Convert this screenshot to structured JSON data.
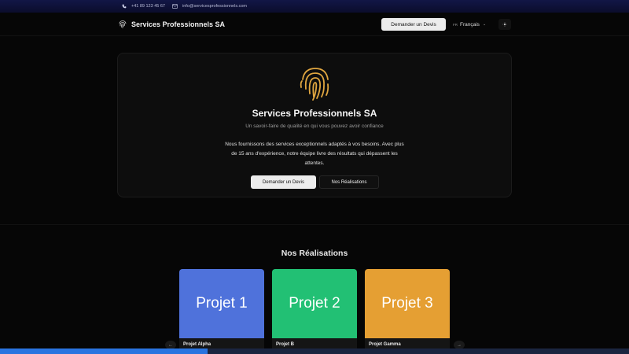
{
  "topbar": {
    "phone": "+41 89 123 45 67",
    "email": "info@servicesprofessionnels.com",
    "phone_icon": "phone-icon",
    "email_icon": "mail-icon"
  },
  "nav": {
    "brand_name": "Services Professionnels SA",
    "brand_icon": "fingerprint-icon",
    "quote_button": "Demander un Devis",
    "lang_code": "FR",
    "lang_label": "Français",
    "theme_icon": "sun-icon"
  },
  "hero": {
    "title": "Services Professionnels SA",
    "subtitle": "Un savoir-faire de qualité en qui vous pouvez avoir confiance",
    "description": "Nous fournissons des services exceptionnels adaptés à vos besoins. Avec plus de 15 ans d'expérience, notre équipe livre des résultats qui dépassent les attentes.",
    "primary_button": "Demander un Devis",
    "secondary_button": "Nos Réalisations",
    "accent_color": "#e0a640"
  },
  "portfolio": {
    "title": "Nos Réalisations",
    "prev_icon": "arrow-left-icon",
    "next_icon": "arrow-right-icon",
    "items": [
      {
        "label": "Projet 1",
        "caption": "Projet Alpha",
        "color": "#4f72db"
      },
      {
        "label": "Projet 2",
        "caption": "Projet B",
        "color": "#22c074"
      },
      {
        "label": "Projet 3",
        "caption": "Projet Gamma",
        "color": "#e59f33"
      }
    ]
  },
  "page_progress": 0.33
}
